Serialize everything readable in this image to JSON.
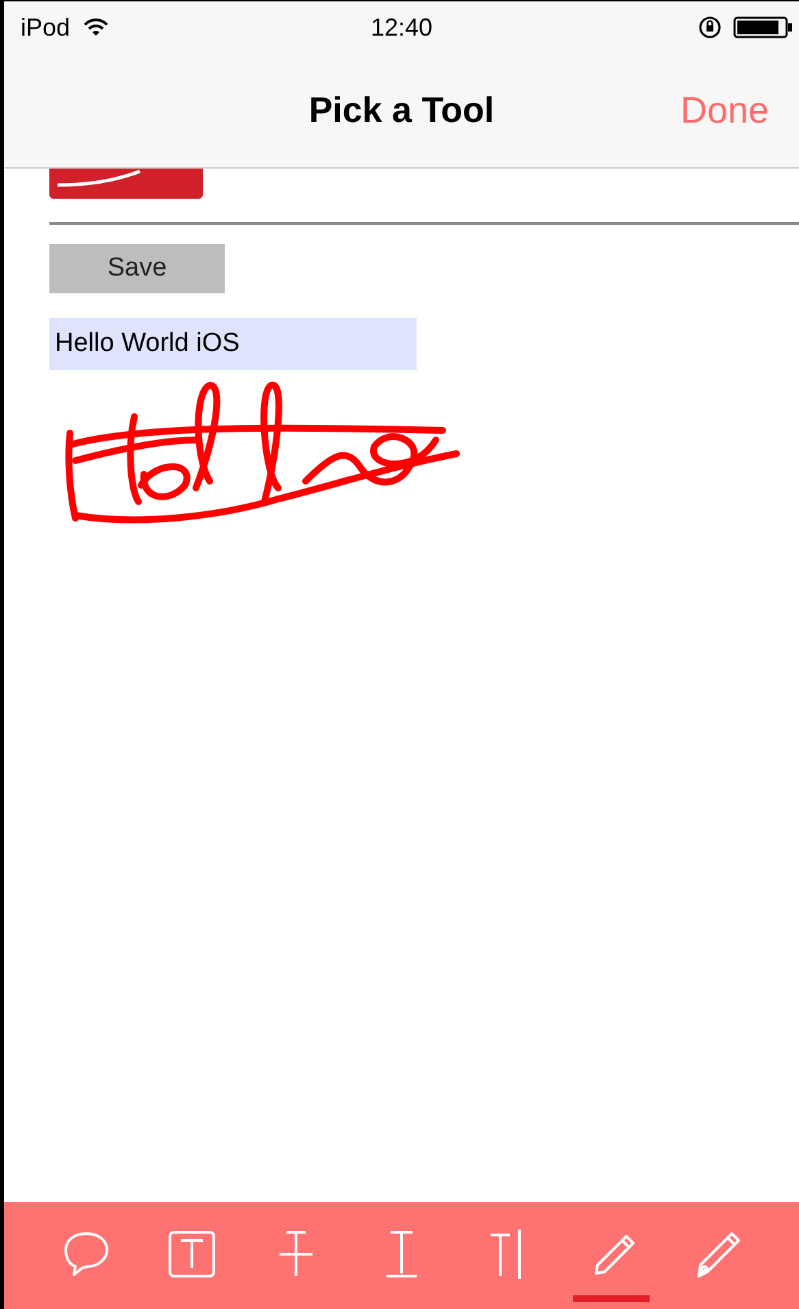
{
  "status_bar": {
    "carrier": "iPod",
    "time": "12:40"
  },
  "nav_bar": {
    "title": "Pick a Tool",
    "done": "Done"
  },
  "save_button": "Save",
  "text_field": {
    "value": "Hello World iOS"
  },
  "toolbar": [
    {
      "kind": "comment",
      "selected": false
    },
    {
      "kind": "textbox",
      "selected": false
    },
    {
      "kind": "strikeout",
      "selected": false
    },
    {
      "kind": "underline",
      "selected": false
    },
    {
      "kind": "caret",
      "selected": false
    },
    {
      "kind": "pen",
      "selected": true
    },
    {
      "kind": "signature",
      "selected": false
    }
  ]
}
